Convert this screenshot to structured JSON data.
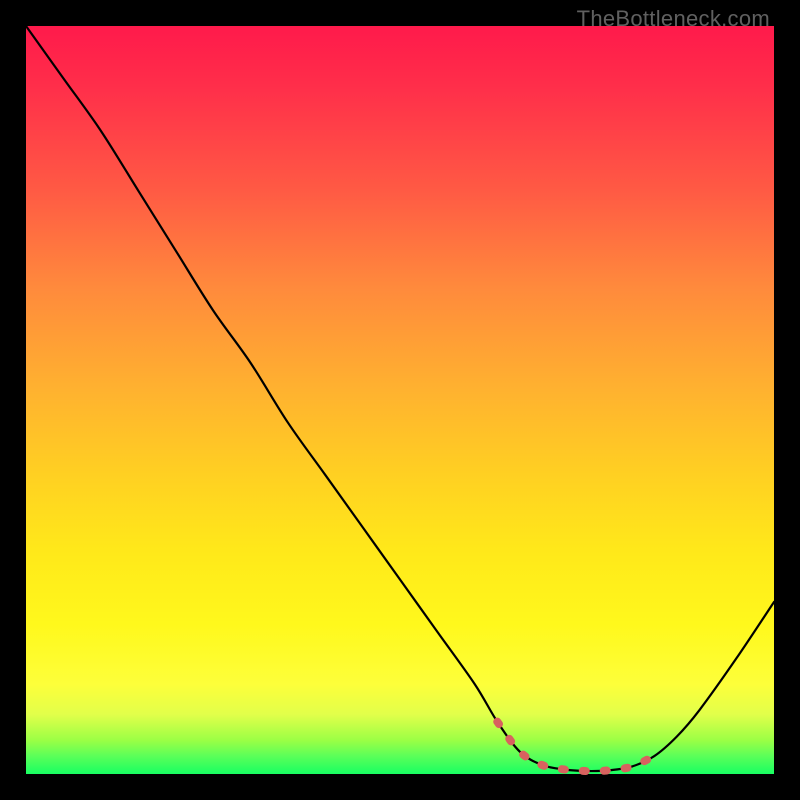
{
  "watermark": "TheBottleneck.com",
  "chart_data": {
    "type": "line",
    "title": "",
    "xlabel": "",
    "ylabel": "",
    "xlim": [
      0,
      100
    ],
    "ylim": [
      0,
      100
    ],
    "x": [
      0,
      5,
      10,
      15,
      20,
      25,
      30,
      35,
      40,
      45,
      50,
      55,
      60,
      63,
      66,
      69,
      72,
      75,
      78,
      81,
      84,
      87,
      90,
      95,
      100
    ],
    "values": [
      100,
      93,
      86,
      78,
      70,
      62,
      55,
      47,
      40,
      33,
      26,
      19,
      12,
      7,
      3,
      1.2,
      0.6,
      0.4,
      0.5,
      1.0,
      2.4,
      5.0,
      8.5,
      15.5,
      23
    ],
    "marker_region_x": [
      63,
      84
    ],
    "gradient_stops": [
      {
        "pos": 0.0,
        "color": "#ff1a4b"
      },
      {
        "pos": 0.22,
        "color": "#ff5a44"
      },
      {
        "pos": 0.48,
        "color": "#ffb030"
      },
      {
        "pos": 0.7,
        "color": "#ffe81a"
      },
      {
        "pos": 0.92,
        "color": "#e2ff4a"
      },
      {
        "pos": 1.0,
        "color": "#18ff62"
      }
    ]
  }
}
